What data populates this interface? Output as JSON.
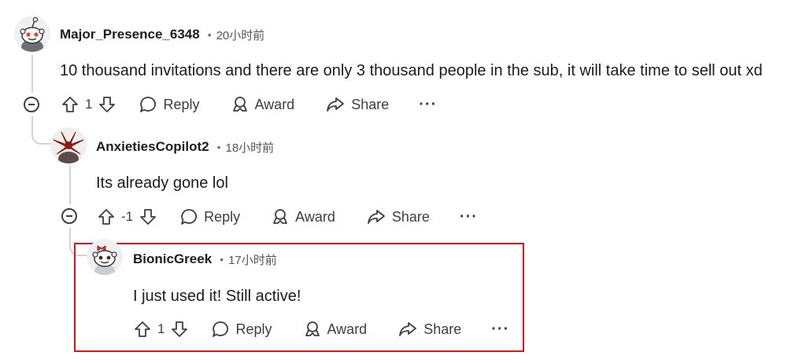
{
  "comments": [
    {
      "author": "Major_Presence_6348",
      "separator": "•",
      "time": "20小时前",
      "body": "10 thousand invitations and there are only 3 thousand people in the sub, it will take time to sell out xd",
      "votes": "1",
      "reply_label": "Reply",
      "award_label": "Award",
      "share_label": "Share",
      "more_label": "···"
    },
    {
      "author": "AnxietiesCopilot2",
      "separator": "•",
      "time": "18小时前",
      "body": "Its already gone lol",
      "votes": "-1",
      "reply_label": "Reply",
      "award_label": "Award",
      "share_label": "Share",
      "more_label": "···"
    },
    {
      "author": "BionicGreek",
      "separator": "•",
      "time": "17小时前",
      "body": "I just used it! Still active!",
      "votes": "1",
      "reply_label": "Reply",
      "award_label": "Award",
      "share_label": "Share",
      "more_label": "···"
    }
  ],
  "colors": {
    "highlight_border": "#e0131a",
    "thread_line": "#d0d4d9",
    "text": "#1c1c1c",
    "muted": "#555555"
  },
  "icons": [
    "reddit-snoo-avatar-icon",
    "upvote-arrow-icon",
    "downvote-arrow-icon",
    "comment-bubble-icon",
    "award-icon",
    "share-arrow-icon",
    "collapse-minus-icon"
  ]
}
